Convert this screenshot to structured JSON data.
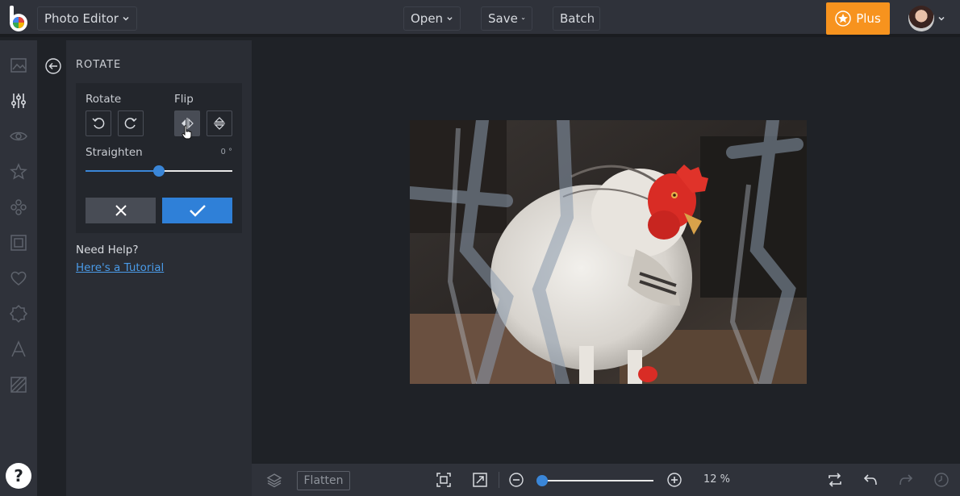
{
  "header": {
    "app_menu": "Photo Editor",
    "open": "Open",
    "save": "Save",
    "batch": "Batch",
    "plus": "Plus"
  },
  "panel": {
    "title": "ROTATE",
    "rotate_label": "Rotate",
    "flip_label": "Flip",
    "straighten_label": "Straighten",
    "straighten_value": "0 °",
    "straighten_fraction": 0.5,
    "help_title": "Need Help?",
    "help_link": "Here's a Tutorial"
  },
  "rail": {
    "icons": [
      "image-icon",
      "adjust-sliders-icon",
      "eye-icon",
      "star-icon",
      "effects-icon",
      "frame-icon",
      "heart-icon",
      "badge-icon",
      "text-icon",
      "texture-icon"
    ],
    "help": "?"
  },
  "bottom": {
    "flatten": "Flatten",
    "zoom": "12 %",
    "zoom_fraction": 0.0
  },
  "colors": {
    "accent": "#2f80d8",
    "plus": "#f7931e"
  }
}
